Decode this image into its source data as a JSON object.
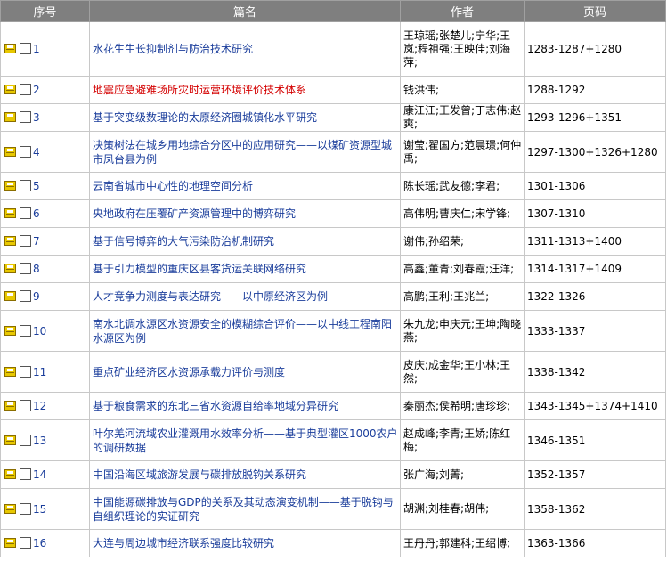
{
  "headers": {
    "seq": "序号",
    "title": "篇名",
    "author": "作者",
    "pages": "页码"
  },
  "rows": [
    {
      "index": "1",
      "title": "水花生生长抑制剂与防治技术研究",
      "authors": "王琼瑶;张楚儿;宁华;王岚;程祖强;王映佳;刘海萍;",
      "pages": "1283-1287+1280",
      "color": "#1a3d9b"
    },
    {
      "index": "2",
      "title": "地震应急避难场所灾时运营环境评价技术体系",
      "authors": "钱洪伟;",
      "pages": "1288-1292",
      "color": "#d40000"
    },
    {
      "index": "3",
      "title": "基于突变级数理论的太原经济圈城镇化水平研究",
      "authors": "康江江;王发曾;丁志伟;赵爽;",
      "pages": "1293-1296+1351",
      "color": "#1a3d9b"
    },
    {
      "index": "4",
      "title": "决策树法在城乡用地综合分区中的应用研究——以煤矿资源型城市凤台县为例",
      "authors": "谢莹;翟国方;范晨璟;何仲禹;",
      "pages": "1297-1300+1326+1280",
      "color": "#1a3d9b"
    },
    {
      "index": "5",
      "title": "云南省城市中心性的地理空间分析",
      "authors": "陈长瑶;武友德;李君;",
      "pages": "1301-1306",
      "color": "#1a3d9b"
    },
    {
      "index": "6",
      "title": "央地政府在压覆矿产资源管理中的博弈研究",
      "authors": "高伟明;曹庆仁;宋学锋;",
      "pages": "1307-1310",
      "color": "#1a3d9b"
    },
    {
      "index": "7",
      "title": "基于信号博弈的大气污染防治机制研究",
      "authors": "谢伟;孙绍荣;",
      "pages": "1311-1313+1400",
      "color": "#1a3d9b"
    },
    {
      "index": "8",
      "title": "基于引力模型的重庆区县客货运关联网络研究",
      "authors": "高鑫;董青;刘春霞;汪洋;",
      "pages": "1314-1317+1409",
      "color": "#1a3d9b"
    },
    {
      "index": "9",
      "title": "人才竞争力测度与表达研究——以中原经济区为例",
      "authors": "高鹏;王利;王兆兰;",
      "pages": "1322-1326",
      "color": "#1a3d9b"
    },
    {
      "index": "10",
      "title": "南水北调水源区水资源安全的模糊综合评价——以中线工程南阳水源区为例",
      "authors": "朱九龙;申庆元;王坤;陶晓燕;",
      "pages": "1333-1337",
      "color": "#1a3d9b"
    },
    {
      "index": "11",
      "title": "重点矿业经济区水资源承载力评价与测度",
      "authors": "皮庆;成金华;王小林;王然;",
      "pages": "1338-1342",
      "color": "#1a3d9b"
    },
    {
      "index": "12",
      "title": "基于粮食需求的东北三省水资源自给率地域分异研究",
      "authors": "秦丽杰;侯希明;唐珍珍;",
      "pages": "1343-1345+1374+1410",
      "color": "#1a3d9b"
    },
    {
      "index": "13",
      "title": "叶尔羌河流域农业灌溉用水效率分析——基于典型灌区1000农户的调研数据",
      "authors": "赵成峰;李青;王娇;陈红梅;",
      "pages": "1346-1351",
      "color": "#1a3d9b"
    },
    {
      "index": "14",
      "title": "中国沿海区域旅游发展与碳排放脱钩关系研究",
      "authors": "张广海;刘菁;",
      "pages": "1352-1357",
      "color": "#1a3d9b"
    },
    {
      "index": "15",
      "title": "中国能源碳排放与GDP的关系及其动态演变机制——基于脱钩与自组织理论的实证研究",
      "authors": "胡渊;刘桂春;胡伟;",
      "pages": "1358-1362",
      "color": "#1a3d9b"
    },
    {
      "index": "16",
      "title": "大连与周边城市经济联系强度比较研究",
      "authors": "王丹丹;郭建科;王绍博;",
      "pages": "1363-1366",
      "color": "#1a3d9b"
    }
  ]
}
